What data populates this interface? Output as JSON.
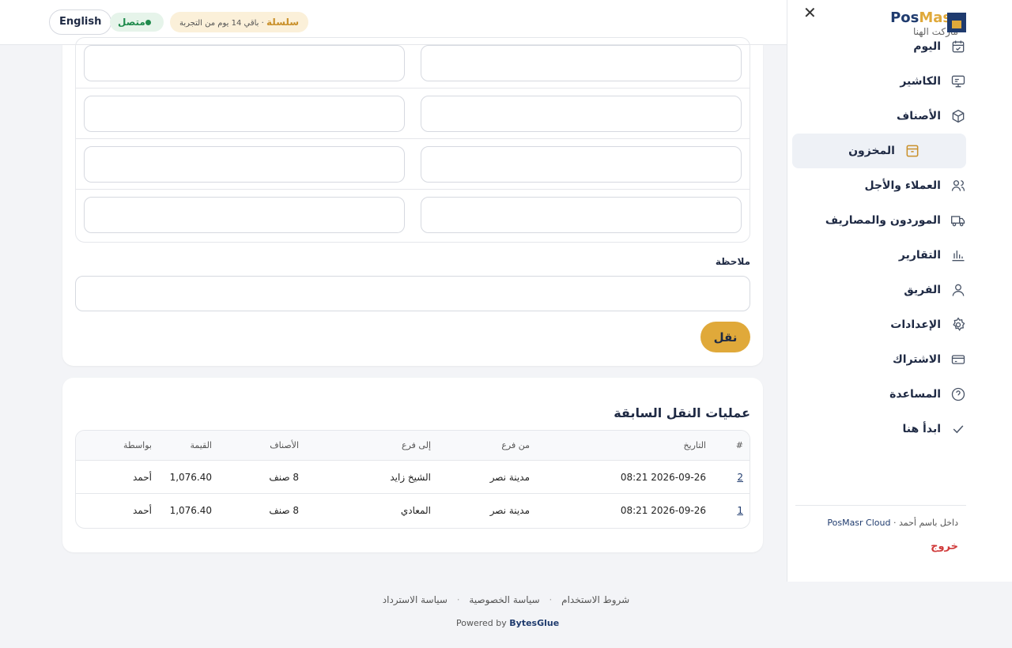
{
  "topbar": {
    "language_button": "English",
    "status_label": "متصل",
    "plan_name": "سلسلة",
    "trial_text": "· باقي 14 يوم من التجربة"
  },
  "sidebar": {
    "brand_part1": "Pos",
    "brand_part2": "Masr",
    "store_name": "ماركت الهنا",
    "items": [
      {
        "label": "اليوم",
        "icon": "calendar-check-icon"
      },
      {
        "label": "الكاشير",
        "icon": "monitor-icon"
      },
      {
        "label": "الأصناف",
        "icon": "box-icon"
      },
      {
        "label": "المخزون",
        "icon": "archive-icon",
        "active": true
      },
      {
        "label": "العملاء والأجل",
        "icon": "users-icon"
      },
      {
        "label": "الموردون والمصاريف",
        "icon": "truck-icon"
      },
      {
        "label": "التقارير",
        "icon": "bar-chart-icon"
      },
      {
        "label": "الفريق",
        "icon": "user-icon"
      },
      {
        "label": "الإعدادات",
        "icon": "gear-icon"
      },
      {
        "label": "الاشتراك",
        "icon": "credit-card-icon"
      },
      {
        "label": "المساعدة",
        "icon": "help-circle-icon"
      },
      {
        "label": "ابدأ هنا",
        "icon": "check-icon"
      }
    ],
    "signed_in_prefix": "داخل باسم أحمد · ",
    "signed_in_cloud": "PosMasr Cloud",
    "logout": "خروج"
  },
  "transfer_form": {
    "note_label": "ملاحظة",
    "note_value": "",
    "submit_label": "نقل"
  },
  "history": {
    "title": "عمليات النقل السابقة",
    "headers": {
      "idx": "#",
      "date": "التاريخ",
      "from": "من فرع",
      "to": "إلى فرع",
      "items": "الأصناف",
      "value": "القيمة",
      "by": "بواسطة"
    },
    "rows": [
      {
        "idx": "2",
        "date": "2026-09-26 08:21",
        "from": "مدينة نصر",
        "to": "الشيخ زايد",
        "items": "8 صنف",
        "value": "1,076.40",
        "by": "أحمد"
      },
      {
        "idx": "1",
        "date": "2026-09-26 08:21",
        "from": "مدينة نصر",
        "to": "المعادي",
        "items": "8 صنف",
        "value": "1,076.40",
        "by": "أحمد"
      }
    ]
  },
  "footer": {
    "terms": "شروط الاستخدام",
    "privacy": "سياسة الخصوصية",
    "refund": "سياسة الاسترداد",
    "powered_prefix": "Powered by",
    "powered_brand": "BytesGlue"
  },
  "colors": {
    "accent": "#e0a93a",
    "brand_blue": "#1f3b6e",
    "online_green": "#1f8a4c",
    "danger": "#d03a3a"
  }
}
